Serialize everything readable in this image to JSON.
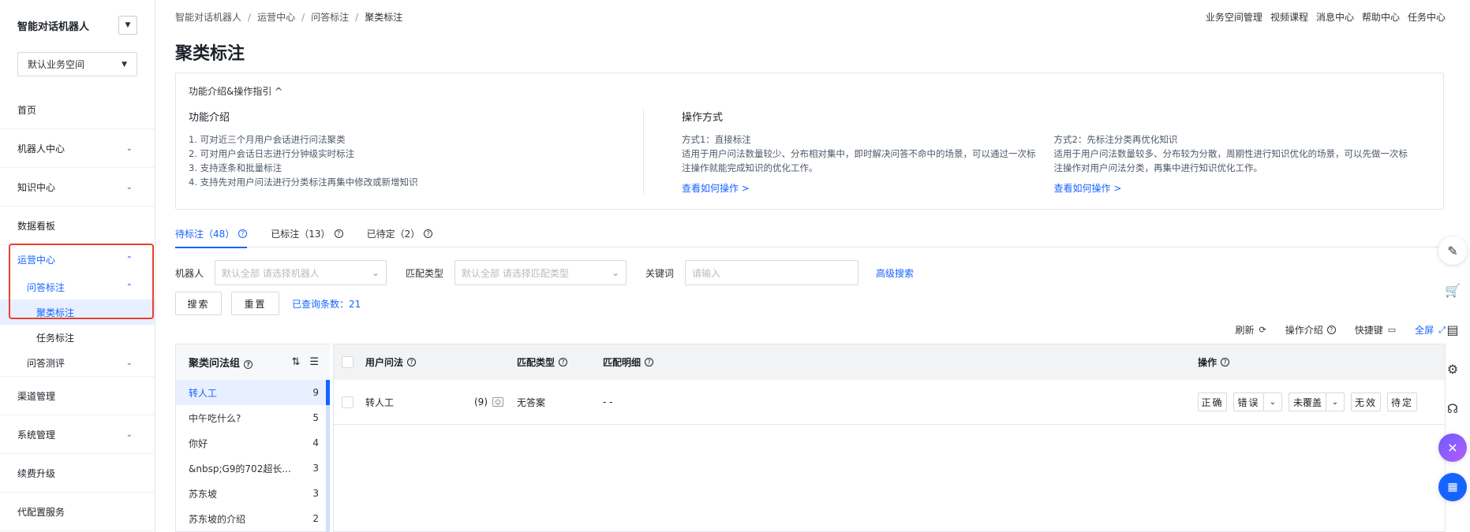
{
  "sidebar": {
    "app_title": "智能对话机器人",
    "workspace": "默认业务空间",
    "items": [
      {
        "label": "首页"
      },
      {
        "label": "机器人中心"
      },
      {
        "label": "知识中心"
      },
      {
        "label": "数据看板"
      },
      {
        "label": "运营中心"
      },
      {
        "label": "渠道管理"
      },
      {
        "label": "系统管理"
      },
      {
        "label": "续费升级"
      },
      {
        "label": "代配置服务"
      }
    ],
    "ops_sub": {
      "qa_label": "问答标注",
      "cluster_label": "聚类标注",
      "task_label": "任务标注",
      "eval_label": "问答测评"
    }
  },
  "breadcrumb": [
    "智能对话机器人",
    "运营中心",
    "问答标注",
    "聚类标注"
  ],
  "top_links": [
    "业务空间管理",
    "视频课程",
    "消息中心",
    "帮助中心",
    "任务中心"
  ],
  "page_title": "聚类标注",
  "intro": {
    "toggle": "功能介绍&操作指引 ^",
    "col1": {
      "heading": "功能介绍",
      "lines": [
        "1. 可对近三个月用户会话进行问法聚类",
        "2. 可对用户会话日志进行分钟级实时标注",
        "3. 支持逐条和批量标注",
        "4. 支持先对用户问法进行分类标注再集中修改或新增知识"
      ]
    },
    "col2": {
      "heading": "操作方式",
      "title": "方式1：直接标注",
      "lines": [
        "适用于用户问法数量较少、分布相对集中，即时解决问答不命中的场景，可以通过一次标",
        "注操作就能完成知识的优化工作。"
      ],
      "link": "查看如何操作 >"
    },
    "col3": {
      "title": "方式2：先标注分类再优化知识",
      "lines": [
        "适用于用户问法数量较多、分布较为分散，周期性进行知识优化的场景，可以先做一次标",
        "注操作对用户问法分类，再集中进行知识优化工作。"
      ],
      "link": "查看如何操作 >"
    }
  },
  "tabs": [
    {
      "label": "待标注（48）"
    },
    {
      "label": "已标注（13）"
    },
    {
      "label": "已待定（2）"
    }
  ],
  "filters": {
    "robot_label": "机器人",
    "robot_placeholder": "默认全部 请选择机器人",
    "match_label": "匹配类型",
    "match_placeholder": "默认全部 请选择匹配类型",
    "keyword_label": "关键词",
    "keyword_placeholder": "请输入",
    "advanced": "高级搜索"
  },
  "actions": {
    "search": "搜索",
    "reset": "重置",
    "count": "已查询条数：21"
  },
  "toolbar": {
    "refresh": "刷新",
    "guide": "操作介绍",
    "shortcut": "快捷键",
    "fullscreen": "全屏"
  },
  "groups": {
    "title": "聚类问法组",
    "rows": [
      {
        "name": "转人工",
        "count": "9"
      },
      {
        "name": "中午吃什么?",
        "count": "5"
      },
      {
        "name": "你好",
        "count": "4"
      },
      {
        "name": "&nbsp;G9的702超长...",
        "count": "3"
      },
      {
        "name": "苏东坡",
        "count": "3"
      },
      {
        "name": "苏东坡的介绍",
        "count": "2"
      }
    ]
  },
  "table": {
    "headers": {
      "question": "用户问法",
      "match_type": "匹配类型",
      "match_detail": "匹配明细",
      "ops": "操作"
    },
    "rows": [
      {
        "question": "转人工",
        "count": "(9)",
        "match_type": "无答案",
        "match_detail": "- -",
        "ops": {
          "correct": "正确",
          "wrong": "错误",
          "uncovered": "未覆盖",
          "invalid": "无效",
          "pending": "待定"
        }
      }
    ]
  },
  "colors": {
    "accent": "#1664ff",
    "highlight_box": "#e8412f"
  }
}
